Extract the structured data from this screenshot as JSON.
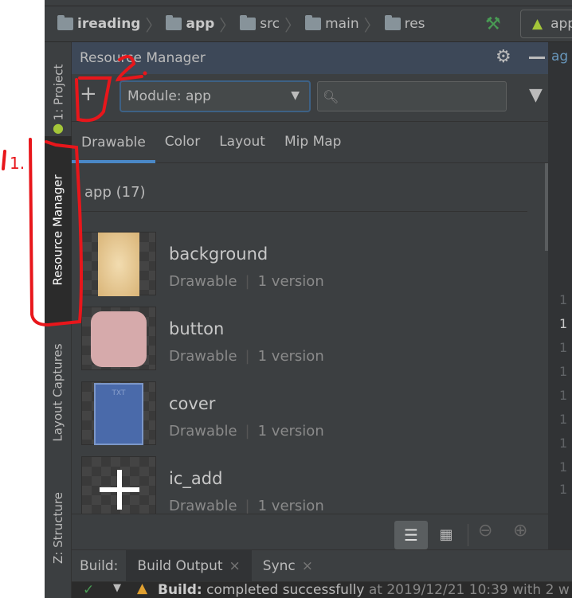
{
  "breadcrumbs": [
    {
      "label": "ireading",
      "bold": true
    },
    {
      "label": "app",
      "bold": true
    },
    {
      "label": "src",
      "bold": false
    },
    {
      "label": "main",
      "bold": false
    },
    {
      "label": "res",
      "bold": false
    }
  ],
  "run_config": {
    "label": "app"
  },
  "side_tabs": {
    "project": "1: Project",
    "resource_manager": "Resource Manager",
    "layout_captures": "Layout Captures",
    "structure": "Z: Structure"
  },
  "panel": {
    "title": "Resource Manager",
    "add_label": "+",
    "module_select": "Module: app",
    "search_placeholder": "",
    "tabs": [
      {
        "label": "Drawable",
        "selected": true
      },
      {
        "label": "Color"
      },
      {
        "label": "Layout"
      },
      {
        "label": "Mip Map"
      }
    ],
    "group": "app (17)",
    "resources": [
      {
        "name": "background",
        "type": "Drawable",
        "versions": "1 version"
      },
      {
        "name": "button",
        "type": "Drawable",
        "versions": "1 version"
      },
      {
        "name": "cover",
        "type": "Drawable",
        "versions": "1 version"
      },
      {
        "name": "ic_add",
        "type": "Drawable",
        "versions": "1 version"
      }
    ],
    "cover_text": "TXT"
  },
  "editor": {
    "tab_fragment": "ag",
    "gutter": [
      "1",
      "1",
      "1",
      "1",
      "1",
      "1",
      "1",
      "1",
      "1"
    ]
  },
  "build": {
    "label": "Build:",
    "tabs": [
      {
        "label": "Build Output",
        "close": "×"
      },
      {
        "label": "Sync",
        "close": "×"
      }
    ],
    "status_prefix": "Build:",
    "status_text": "completed successfully",
    "status_time": "at 2019/12/21 10:39  with 2 w"
  },
  "annotations": [
    "1.",
    "2."
  ],
  "colors": {
    "accent": "#4a88c7",
    "annotation": "#e8161b",
    "success": "#499c54"
  }
}
